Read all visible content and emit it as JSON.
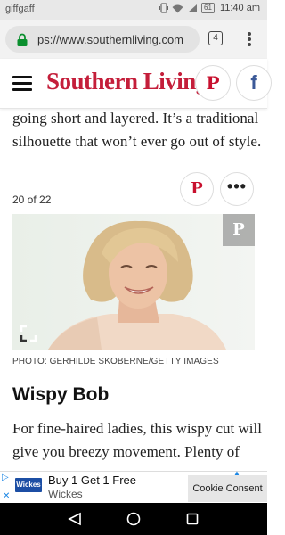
{
  "status_bar": {
    "carrier": "giffgaff",
    "battery": "61",
    "time": "11:40 am"
  },
  "browser": {
    "url": "ps://www.southernliving.com",
    "tab_count": "4"
  },
  "site": {
    "logo": "Southern Living",
    "pinterest_glyph": "P",
    "facebook_glyph": "f"
  },
  "article": {
    "intro_line1": "going short and layered. It’s a traditional",
    "intro_line2": "silhouette that won’t ever go out of style.",
    "slide_counter": "20 of 22",
    "pin_glyph": "P",
    "more_glyph": "•••",
    "photo_pin_glyph": "P",
    "photo_credit": "PHOTO: GERHILDE SKOBERNE/GETTY IMAGES",
    "headline": "Wispy Bob",
    "para_line1": "For fine-haired ladies, this wispy cut will",
    "para_line2": "give you breezy movement. Plenty of"
  },
  "ad": {
    "info_glyph": "▷",
    "close_glyph": "✕",
    "logo_text": "Wickes",
    "title": "Buy 1 Get 1 Free",
    "brand": "Wickes",
    "cookie_label": "Cookie Consent"
  },
  "icons": {
    "lock": "lock-icon",
    "menu": "overflow-menu-icon",
    "hamburger": "hamburger-icon",
    "expand": "expand-icon",
    "back": "back-icon",
    "home": "home-icon",
    "recent": "recent-apps-icon"
  },
  "colors": {
    "brand_red": "#c41e3a",
    "secure_green": "#0a8f2e",
    "facebook_blue": "#3b5998",
    "ad_blue": "#1c4ea4"
  }
}
